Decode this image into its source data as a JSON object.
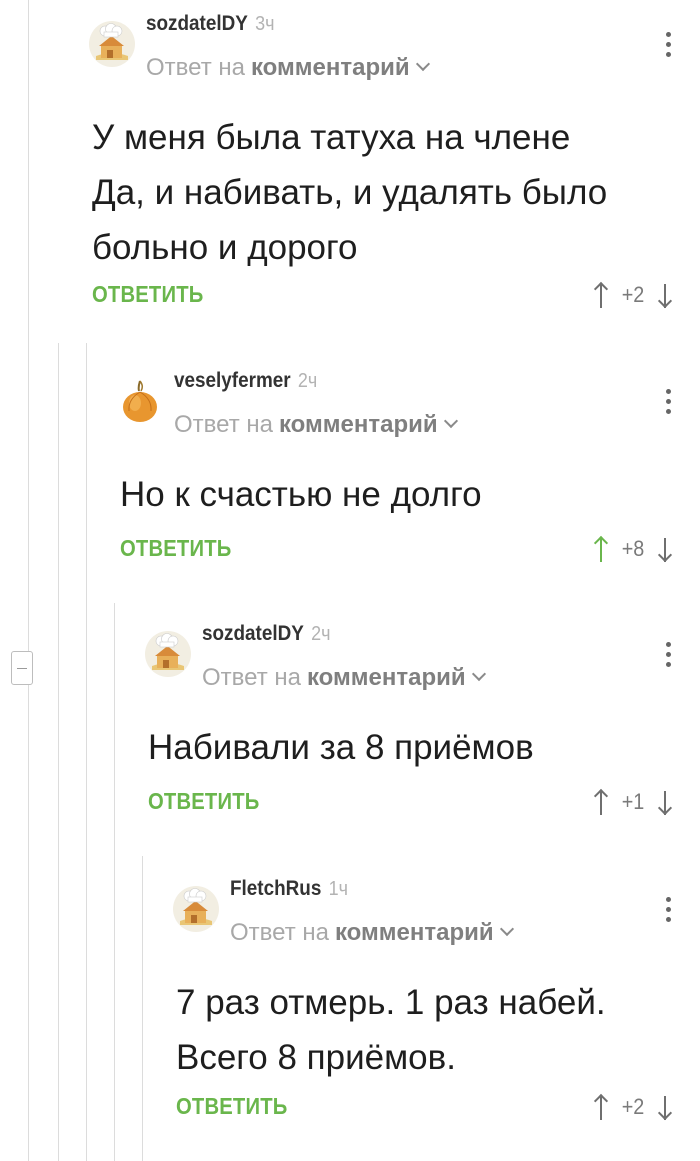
{
  "colors": {
    "reply_green": "#6ab64c",
    "thread_line": "#dcdcdc",
    "muted_text": "#a8a8a8"
  },
  "icons": {
    "collapse": "minus-box-icon",
    "menu": "vertical-dots-icon",
    "upvote": "arrow-up-icon",
    "downvote": "arrow-down-icon",
    "avatar_default": "chef-house-avatar",
    "avatar_onion": "onion-avatar"
  },
  "comments": [
    {
      "user": "sozdatelDY",
      "time": "3ч",
      "reply_prefix": "Ответ на",
      "reply_target": "комментарий",
      "lines": [
        "У меня была татуха на члене",
        "Да, и набивать, и удалять было",
        "больно и дорого"
      ],
      "reply_label": "ОТВЕТИТЬ",
      "score": "+2",
      "upvoted": false
    },
    {
      "user": "veselyfermer",
      "time": "2ч",
      "reply_prefix": "Ответ на",
      "reply_target": "комментарий",
      "lines": [
        "Но к счастью не долго"
      ],
      "reply_label": "ОТВЕТИТЬ",
      "score": "+8",
      "upvoted": true
    },
    {
      "user": "sozdatelDY",
      "time": "2ч",
      "reply_prefix": "Ответ на",
      "reply_target": "комментарий",
      "lines": [
        "Набивали за 8 приёмов"
      ],
      "reply_label": "ОТВЕТИТЬ",
      "score": "+1",
      "upvoted": false
    },
    {
      "user": "FletchRus",
      "time": "1ч",
      "reply_prefix": "Ответ на",
      "reply_target": "комментарий",
      "lines": [
        "7 раз отмерь. 1 раз набей.",
        "Всего 8 приёмов."
      ],
      "reply_label": "ОТВЕТИТЬ",
      "score": "+2",
      "upvoted": false
    }
  ]
}
